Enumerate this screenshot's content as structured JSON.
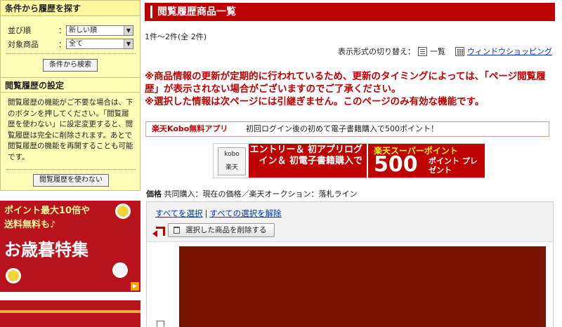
{
  "sidebar": {
    "search_panel": {
      "title": "条件から履歴を探す",
      "sort_label": "並び順",
      "sort_value": "新しい順",
      "target_label": "対象商品",
      "target_value": "全て",
      "colon": "：",
      "search_button": "条件から検索"
    },
    "history_panel": {
      "title": "閲覧履歴の設定",
      "description": "閲覧履歴の機能がご不要な場合は、下のボタンを押してください。「閲覧履歴を使わない」に設定変更すると、閲覧履歴は完全に削除されます。あとで閲覧履歴の機能を再開することも可能です。",
      "disable_button": "閲覧履歴を使わない"
    },
    "promo_banner": {
      "line1": "ポイント最大10倍や",
      "line2": "送料無料も♪",
      "headline": "お歳暮特集"
    }
  },
  "main": {
    "title": "閲覧履歴商品一覧",
    "count": "1件～2件(全 2件)",
    "view_switch": {
      "label": "表示形式の切り替え：",
      "list_label": "一覧",
      "window_label": "ウィンドウショッピング"
    },
    "notice_line1": "※商品情報の更新が定期的に行われているため、更新のタイミングによっては、「ページ閲覧履歴」が表示されない場合がございますのでご了承ください。",
    "notice_line2": "※選択した情報は次ページには引継ぎません。このページのみ有効な機能です。",
    "kobo_bar": {
      "app": "楽天Kobo無料アプリ",
      "text": "初回ログイン後の初めて電子書籍購入で500ポイント！"
    },
    "kobo_banner": {
      "logo_top": "kobo",
      "logo_bottom": "楽天",
      "mid_text": "エントリー＆ 初アプリログイン＆ 初電子書籍購入で",
      "super": "楽天スーパーポイント",
      "number": "500",
      "points": "ポイント プレゼント"
    },
    "price_legend": {
      "key": "価格",
      "text": "共同購入：現在の価格／楽天オークション：落札ライン"
    },
    "list": {
      "select_all": "すべてを選択",
      "deselect_all": "すべての選択を解除",
      "delete_button": "選択した商品を削除する"
    }
  },
  "colors": {
    "accent_red": "#bf0000",
    "sidebar_bg": "#ffffb8",
    "link_blue": "#0033cc"
  }
}
